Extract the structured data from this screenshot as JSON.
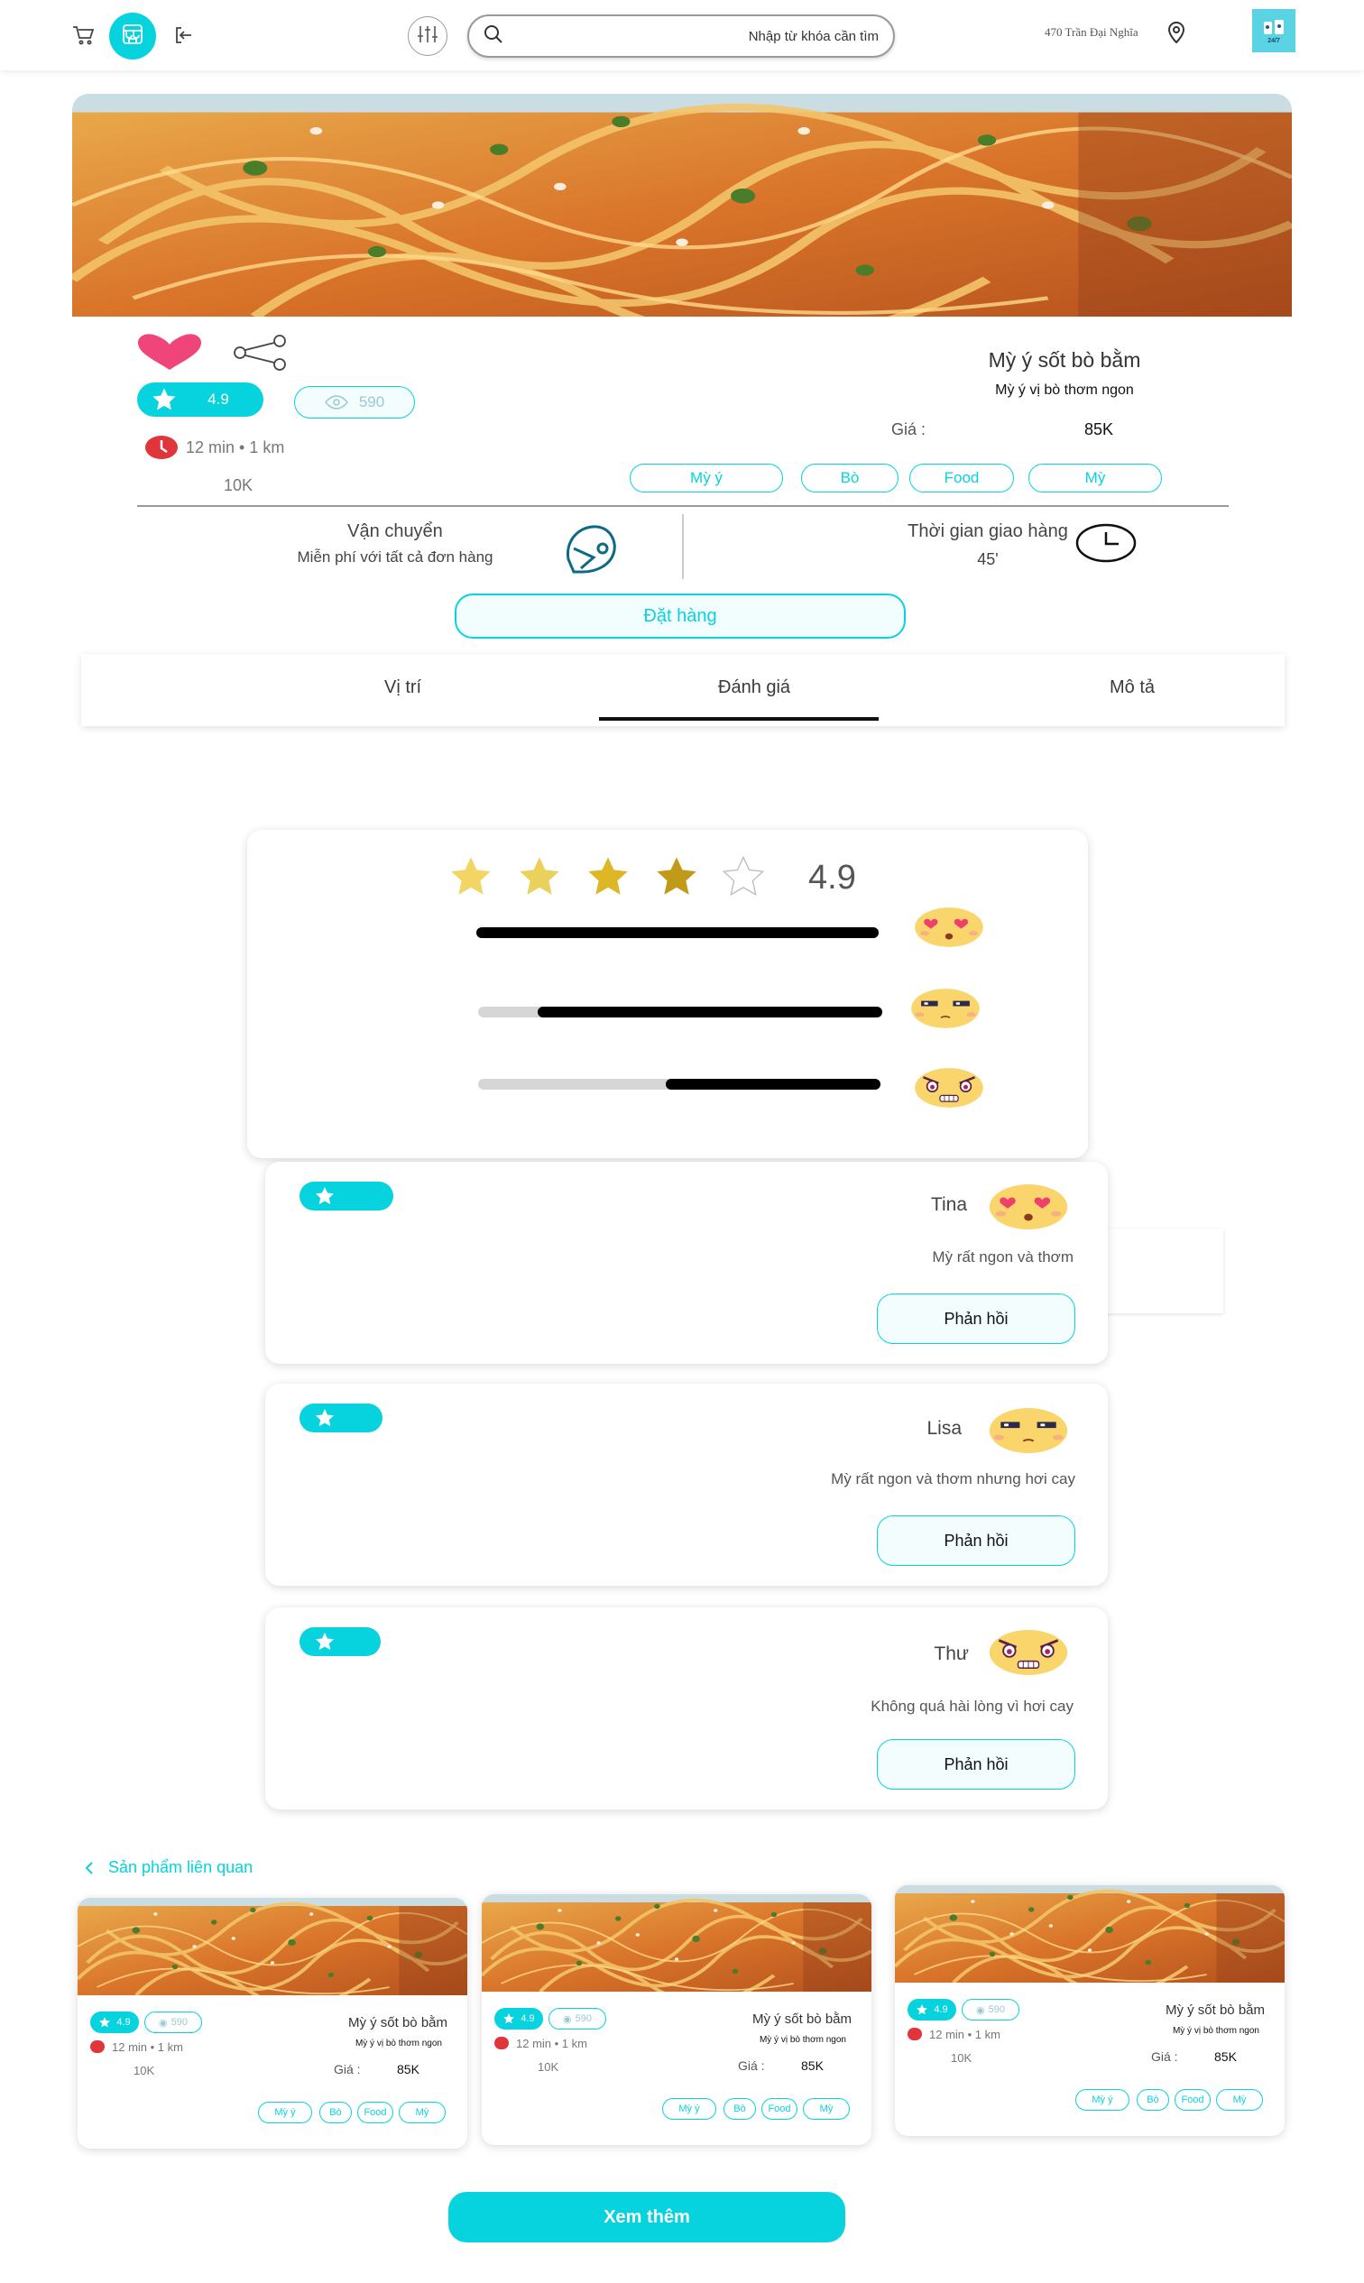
{
  "header": {
    "search_placeholder": "Nhập từ khóa cần tìm",
    "address": "470 Trần Đại Nghĩa",
    "logo_text": "24/7"
  },
  "product": {
    "name": "Mỳ ý sốt bò bằm",
    "subtitle": "Mỳ ý vị bò thơm ngon",
    "price_label": "Giá :",
    "price": "85K",
    "rating": "4.9",
    "views": "590",
    "time_distance": "12 min • 1 km",
    "shipping_cost": "10K",
    "tags": [
      "Mỳ ý",
      "Bò",
      "Food",
      "Mỳ"
    ]
  },
  "delivery": {
    "shipping_title": "Vận chuyển",
    "shipping_desc": "Miễn phí  với tất cả đơn hàng",
    "time_title": "Thời gian giao hàng",
    "time_value": "45'"
  },
  "order_button": "Đặt hàng",
  "tabs": [
    {
      "label": "Vị trí",
      "active": false
    },
    {
      "label": "Đánh giá",
      "active": true
    },
    {
      "label": "Mô tả",
      "active": false
    }
  ],
  "rating_summary": {
    "score": "4.9",
    "stars": 4.5,
    "bars": [
      {
        "emoji": "love-emoji",
        "fill": 1.0
      },
      {
        "emoji": "neutral-emoji",
        "fill": 0.85
      },
      {
        "emoji": "angry-emoji",
        "fill": 0.53
      }
    ]
  },
  "reviews": [
    {
      "name": "Tina",
      "comment": "Mỳ rất ngon và thơm",
      "emoji": "love-emoji",
      "reply": "Phản hồi"
    },
    {
      "name": "Lisa",
      "comment": "Mỳ rất ngon và thơm nhưng hơi cay",
      "emoji": "neutral-emoji",
      "reply": "Phản hồi"
    },
    {
      "name": "Thư",
      "comment": "Không quá hài lòng  vì hơi cay",
      "emoji": "angry-emoji",
      "reply": "Phản hồi"
    }
  ],
  "related": {
    "title": "Sản phẩm liên quan",
    "items": [
      {
        "name": "Mỳ ý sốt bò bằm",
        "subtitle": "Mỳ ý vị bò thơm ngon",
        "rating": "4.9",
        "views": "590",
        "time_distance": "12 min • 1 km",
        "shipping": "10K",
        "price_label": "Giá :",
        "price": "85K",
        "tags": [
          "Mỳ ý",
          "Bò",
          "Food",
          "Mỳ"
        ]
      },
      {
        "name": "Mỳ ý sốt bò bằm",
        "subtitle": "Mỳ ý vị bò thơm ngon",
        "rating": "4.9",
        "views": "590",
        "time_distance": "12 min • 1 km",
        "shipping": "10K",
        "price_label": "Giá :",
        "price": "85K",
        "tags": [
          "Mỳ ý",
          "Bò",
          "Food",
          "Mỳ"
        ]
      },
      {
        "name": "Mỳ ý sốt bò bằm",
        "subtitle": "Mỳ ý vị bò thơm ngon",
        "rating": "4.9",
        "views": "590",
        "time_distance": "12 min • 1 km",
        "shipping": "10K",
        "price_label": "Giá :",
        "price": "85K",
        "tags": [
          "Mỳ ý",
          "Bò",
          "Food",
          "Mỳ"
        ]
      }
    ]
  },
  "more_button": "Xem thêm",
  "colors": {
    "accent": "#06d3de",
    "heart": "#f0457a",
    "clock_red": "#e0353b",
    "star_gold": "#e2b92b"
  }
}
